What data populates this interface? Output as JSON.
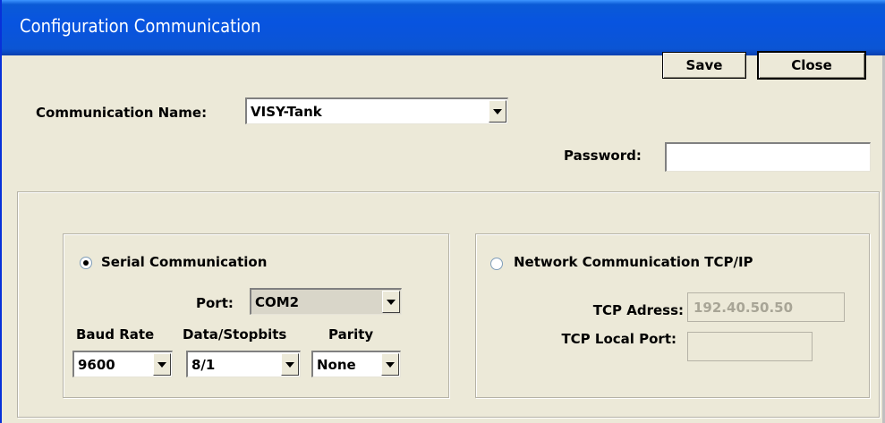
{
  "window": {
    "title": "Configuration Communication"
  },
  "toolbar": {
    "save_label": "Save",
    "close_label": "Close"
  },
  "communication": {
    "name_label": "Communication Name:",
    "name_value": "VISY-Tank"
  },
  "password": {
    "label": "Password:",
    "value": ""
  },
  "serial": {
    "radio_label": "Serial Communication",
    "selected": true,
    "port_label": "Port:",
    "port_value": "COM2",
    "baud_label": "Baud Rate",
    "baud_value": "9600",
    "data_label": "Data/Stopbits",
    "data_value": "8/1",
    "parity_label": "Parity",
    "parity_value": "None"
  },
  "network": {
    "radio_label": "Network Communication TCP/IP",
    "selected": false,
    "address_label": "TCP Adress:",
    "address_value": "192.40.50.50",
    "local_port_label": "TCP Local Port:",
    "local_port_value": ""
  },
  "colors": {
    "titlebar": "#0854e0",
    "face": "#ece9d8",
    "disabled_text": "#a8a596"
  }
}
